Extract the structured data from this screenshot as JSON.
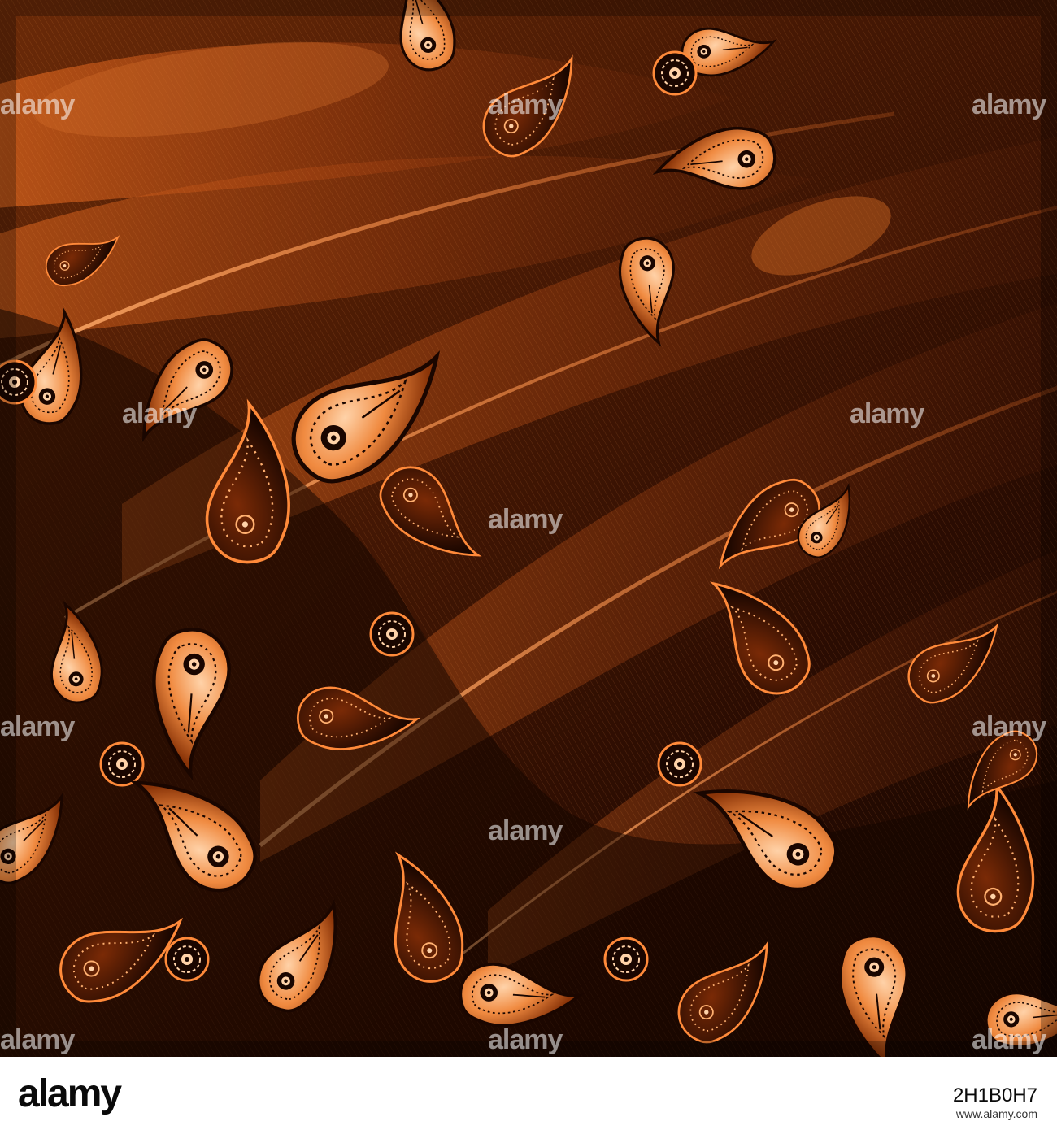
{
  "image": {
    "subject": "orange-feathers-paisley-pattern",
    "colors": {
      "background": "#1a0700",
      "deep": "#3a1202",
      "feather": "#b04a10",
      "highlight": "#ff8a3a",
      "pale": "#ffd2a8",
      "ink": "#120400"
    }
  },
  "watermarks": {
    "text": "alamy",
    "count": 12
  },
  "footer": {
    "logo": "alamy",
    "image_id": "2H1B0H7",
    "url": "www.alamy.com"
  }
}
